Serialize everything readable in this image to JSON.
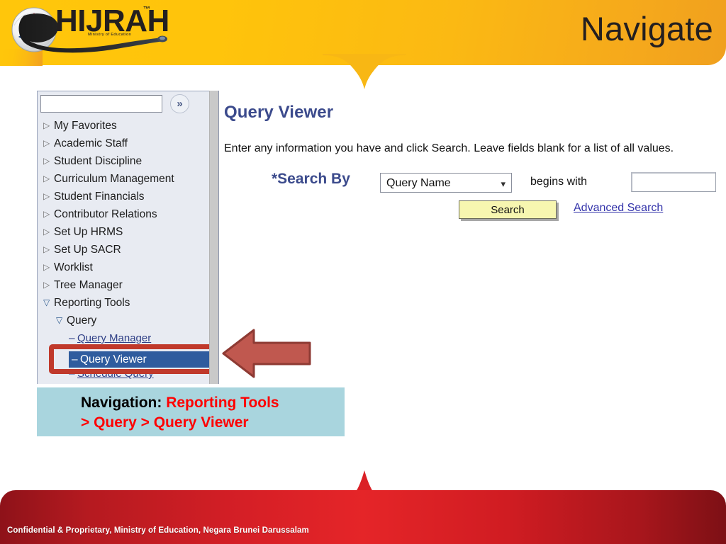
{
  "header": {
    "title": "Navigate",
    "logo": {
      "wordmark": "HIJRAH",
      "trademark": "™",
      "tagline": "Ministry of Education"
    },
    "colors": {
      "gradient_start": "#FFC60B",
      "gradient_end": "#F0A01E"
    }
  },
  "footer": {
    "text": "Confidential & Proprietary, Ministry of Education, Negara Brunei Darussalam",
    "colors": {
      "edge": "#8e1219",
      "center": "#e52528"
    }
  },
  "peoplesoft": {
    "nav": {
      "search_placeholder": "",
      "search_value": "",
      "go_icon": "double-chevron-right-icon",
      "items": [
        {
          "label": "My Favorites",
          "marker": "▷",
          "level": 0,
          "expanded": false
        },
        {
          "label": "Academic Staff",
          "marker": "▷",
          "level": 0,
          "expanded": false
        },
        {
          "label": "Student Discipline",
          "marker": "▷",
          "level": 0,
          "expanded": false
        },
        {
          "label": "Curriculum Management",
          "marker": "▷",
          "level": 0,
          "expanded": false
        },
        {
          "label": "Student Financials",
          "marker": "▷",
          "level": 0,
          "expanded": false
        },
        {
          "label": "Contributor Relations",
          "marker": "▷",
          "level": 0,
          "expanded": false
        },
        {
          "label": "Set Up HRMS",
          "marker": "▷",
          "level": 0,
          "expanded": false
        },
        {
          "label": "Set Up SACR",
          "marker": "▷",
          "level": 0,
          "expanded": false
        },
        {
          "label": "Worklist",
          "marker": "▷",
          "level": 0,
          "expanded": false
        },
        {
          "label": "Tree Manager",
          "marker": "▷",
          "level": 0,
          "expanded": false
        },
        {
          "label": "Reporting Tools",
          "marker": "▽",
          "level": 0,
          "expanded": true
        },
        {
          "label": "Query",
          "marker": "▽",
          "level": 1,
          "expanded": true
        }
      ],
      "leaves": [
        {
          "label": "Query Manager",
          "marker": "–",
          "selected": false
        },
        {
          "label": "Query Viewer",
          "marker": "–",
          "selected": true
        },
        {
          "label": "Schedule Query",
          "marker": "–",
          "selected": false
        }
      ],
      "selected_color": "#2F5C9E",
      "highlight_color": "#C0392B"
    },
    "content": {
      "title": "Query Viewer",
      "instructions": "Enter any information you have and click Search. Leave fields blank for a list of all values.",
      "search_by_label": "*Search By",
      "search_by_value": "Query Name",
      "search_by_options": [
        "Query Name"
      ],
      "operator_label": "begins with",
      "search_value": "",
      "search_button_label": "Search",
      "advanced_search_label": "Advanced Search"
    }
  },
  "annotation": {
    "arrow": "left-pointing-arrow",
    "arrow_color": "#C0584F",
    "callout_bg": "#A9D5DE",
    "line1_prefix": "Navigation: ",
    "line1_highlight": "Reporting Tools",
    "line2": "> Query > Query Viewer"
  }
}
